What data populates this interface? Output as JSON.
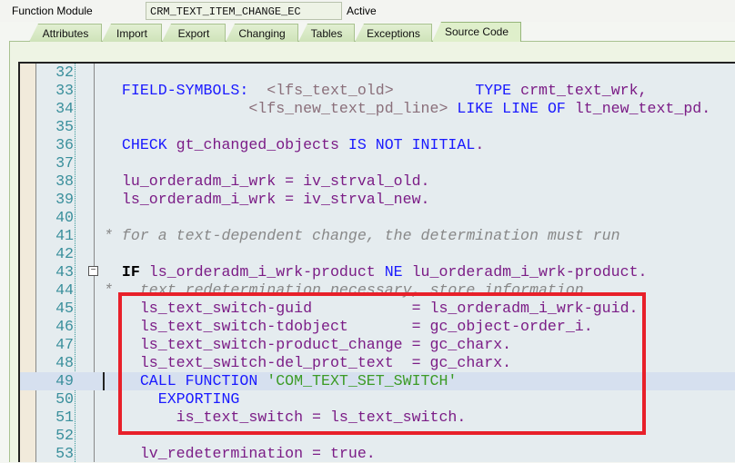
{
  "header": {
    "label": "Function Module",
    "name": "CRM_TEXT_ITEM_CHANGE_EC",
    "status": "Active"
  },
  "tabs": [
    "Attributes",
    "Import",
    "Export",
    "Changing",
    "Tables",
    "Exceptions",
    "Source Code"
  ],
  "active_tab": "Source Code",
  "code": [
    {
      "n": "32",
      "t": []
    },
    {
      "n": "33",
      "t": [
        [
          "  ",
          ""
        ],
        [
          "FIELD-SYMBOLS:",
          "kw"
        ],
        [
          "  ",
          ""
        ],
        [
          "<lfs_text_old>",
          "fs"
        ],
        [
          "         ",
          ""
        ],
        [
          "TYPE",
          "kw"
        ],
        [
          " crmt_text_wrk,",
          ""
        ]
      ]
    },
    {
      "n": "34",
      "t": [
        [
          "                ",
          ""
        ],
        [
          "<lfs_new_text_pd_line>",
          "fs"
        ],
        [
          " ",
          ""
        ],
        [
          "LIKE LINE OF",
          "kw"
        ],
        [
          " lt_new_text_pd.",
          ""
        ]
      ]
    },
    {
      "n": "35",
      "t": []
    },
    {
      "n": "36",
      "t": [
        [
          "  ",
          ""
        ],
        [
          "CHECK",
          "kw"
        ],
        [
          " gt_changed_objects ",
          ""
        ],
        [
          "IS NOT INITIAL",
          "kw"
        ],
        [
          ".",
          ""
        ]
      ]
    },
    {
      "n": "37",
      "t": []
    },
    {
      "n": "38",
      "t": [
        [
          "  lu_orderadm_i_wrk = iv_strval_old.",
          ""
        ]
      ]
    },
    {
      "n": "39",
      "t": [
        [
          "  ls_orderadm_i_wrk = iv_strval_new.",
          ""
        ]
      ]
    },
    {
      "n": "40",
      "t": []
    },
    {
      "n": "41",
      "t": [
        [
          "* for a text-dependent change, the determination must run",
          "cmt"
        ]
      ]
    },
    {
      "n": "42",
      "t": []
    },
    {
      "n": "43",
      "t": [
        [
          "  ",
          ""
        ],
        [
          "IF",
          "kwb"
        ],
        [
          " ls_orderadm_i_wrk-product ",
          ""
        ],
        [
          "NE",
          "kw"
        ],
        [
          " lu_orderadm_i_wrk-product.",
          ""
        ]
      ]
    },
    {
      "n": "44",
      "t": [
        [
          "*   text redetermination necessary, store information",
          "cmt"
        ]
      ]
    },
    {
      "n": "45",
      "t": [
        [
          "    ls_text_switch-guid           = ls_orderadm_i_wrk-guid.",
          ""
        ]
      ]
    },
    {
      "n": "46",
      "t": [
        [
          "    ls_text_switch-tdobject       = gc_object-order_i.",
          ""
        ]
      ]
    },
    {
      "n": "47",
      "t": [
        [
          "    ls_text_switch-product_change = gc_charx.",
          ""
        ]
      ]
    },
    {
      "n": "48",
      "t": [
        [
          "    ls_text_switch-del_prot_text  = gc_charx.",
          ""
        ]
      ]
    },
    {
      "n": "49",
      "t": [
        [
          "    ",
          ""
        ],
        [
          "CALL FUNCTION",
          "kw"
        ],
        [
          " ",
          ""
        ],
        [
          "'COM_TEXT_SET_SWITCH'",
          "str"
        ]
      ]
    },
    {
      "n": "50",
      "t": [
        [
          "      ",
          ""
        ],
        [
          "EXPORTING",
          "kw"
        ]
      ]
    },
    {
      "n": "51",
      "t": [
        [
          "        is_text_switch = ls_text_switch.",
          ""
        ]
      ]
    },
    {
      "n": "52",
      "t": []
    },
    {
      "n": "53",
      "t": [
        [
          "    lv_redetermination = true.",
          ""
        ]
      ]
    }
  ]
}
